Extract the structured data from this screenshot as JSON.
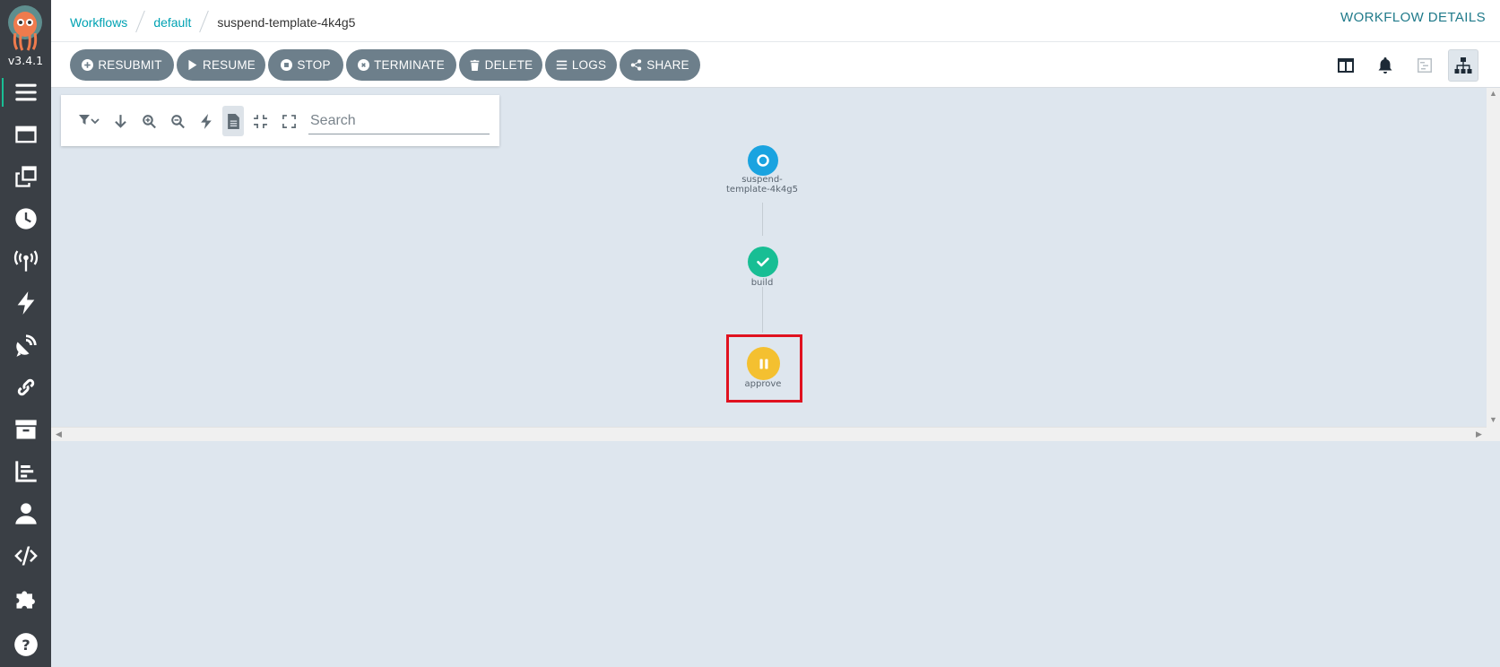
{
  "app": {
    "version": "v3.4.1",
    "logo_icon": "argo-octopus-logo"
  },
  "sidebar": {
    "items": [
      {
        "name": "workflows",
        "icon": "hamburger-list-icon",
        "active": true
      },
      {
        "name": "workflow-templates",
        "icon": "window-icon"
      },
      {
        "name": "cluster-workflow-templates",
        "icon": "clone-icon"
      },
      {
        "name": "cron-workflows",
        "icon": "clock-icon"
      },
      {
        "name": "event-sources",
        "icon": "broadcast-tower-icon"
      },
      {
        "name": "sensors",
        "icon": "bolt-icon"
      },
      {
        "name": "event-flow",
        "icon": "satellite-dish-icon"
      },
      {
        "name": "workflow-event-bindings",
        "icon": "link-icon"
      },
      {
        "name": "archived-workflows",
        "icon": "archive-icon"
      },
      {
        "name": "reports",
        "icon": "chart-bar-icon"
      },
      {
        "name": "user",
        "icon": "user-icon"
      },
      {
        "name": "api-docs",
        "icon": "code-icon"
      },
      {
        "name": "plugins",
        "icon": "puzzle-piece-icon"
      },
      {
        "name": "help",
        "icon": "question-icon"
      }
    ]
  },
  "header": {
    "breadcrumb": {
      "workflows": "Workflows",
      "namespace": "default",
      "current": "suspend-template-4k4g5"
    },
    "title": "WORKFLOW DETAILS"
  },
  "actions": {
    "resubmit": "RESUBMIT",
    "resume": "RESUME",
    "stop": "STOP",
    "terminate": "TERMINATE",
    "delete": "DELETE",
    "logs": "LOGS",
    "share": "SHARE"
  },
  "view_tools": [
    {
      "name": "summary-panel",
      "icon": "columns-icon"
    },
    {
      "name": "events",
      "icon": "bell-icon"
    },
    {
      "name": "timeline",
      "icon": "timeline-icon"
    },
    {
      "name": "graph",
      "icon": "sitemap-icon",
      "selected": true
    }
  ],
  "graph_toolbar": {
    "search_placeholder": "Search",
    "tools": [
      "filter-icon",
      "arrow-down-icon",
      "zoom-in-icon",
      "zoom-out-icon",
      "bolt-icon",
      "file-icon",
      "compress-icon",
      "expand-icon"
    ]
  },
  "graph": {
    "nodes": [
      {
        "id": "root",
        "label_line1": "suspend-",
        "label_line2": "template-4k4g5",
        "status": "running",
        "color": "#1aa3e0"
      },
      {
        "id": "build",
        "label": "build",
        "status": "succeeded",
        "color": "#18be94"
      },
      {
        "id": "approve",
        "label": "approve",
        "status": "suspended",
        "color": "#f4c030",
        "highlighted": true
      }
    ]
  },
  "colors": {
    "sidebar": "#3a3f45",
    "accent": "#00a2b3",
    "button": "#6d7f8b",
    "canvas": "#dee6ee",
    "highlight": "#e0121f"
  }
}
